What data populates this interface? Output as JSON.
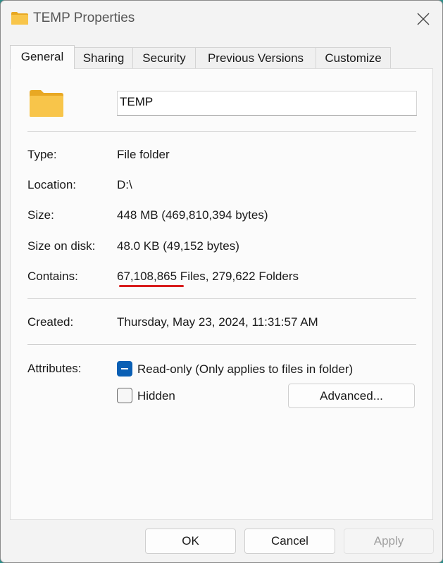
{
  "window": {
    "title": "TEMP Properties"
  },
  "tabs": [
    {
      "label": "General"
    },
    {
      "label": "Sharing"
    },
    {
      "label": "Security"
    },
    {
      "label": "Previous Versions"
    },
    {
      "label": "Customize"
    }
  ],
  "general": {
    "folder_name": "TEMP",
    "type": {
      "label": "Type:",
      "value": "File folder"
    },
    "location": {
      "label": "Location:",
      "value": "D:\\"
    },
    "size": {
      "label": "Size:",
      "value": "448 MB (469,810,394 bytes)"
    },
    "size_on_disk": {
      "label": "Size on disk:",
      "value": "48.0 KB (49,152 bytes)"
    },
    "contains": {
      "label": "Contains:",
      "value": "67,108,865 Files, 279,622 Folders"
    },
    "created": {
      "label": "Created:",
      "value": "Thursday, May 23, 2024, 11:31:57 AM"
    },
    "attributes": {
      "label": "Attributes:",
      "readonly_label": "Read-only (Only applies to files in folder)",
      "readonly_state": "indeterminate",
      "hidden_label": "Hidden",
      "hidden_checked": false,
      "advanced_label": "Advanced..."
    }
  },
  "footer": {
    "ok_label": "OK",
    "cancel_label": "Cancel",
    "apply_label": "Apply",
    "apply_enabled": false
  },
  "colors": {
    "accent": "#0a5fb4",
    "folder": "#f8c54a",
    "annotation": "#d81b1b"
  }
}
